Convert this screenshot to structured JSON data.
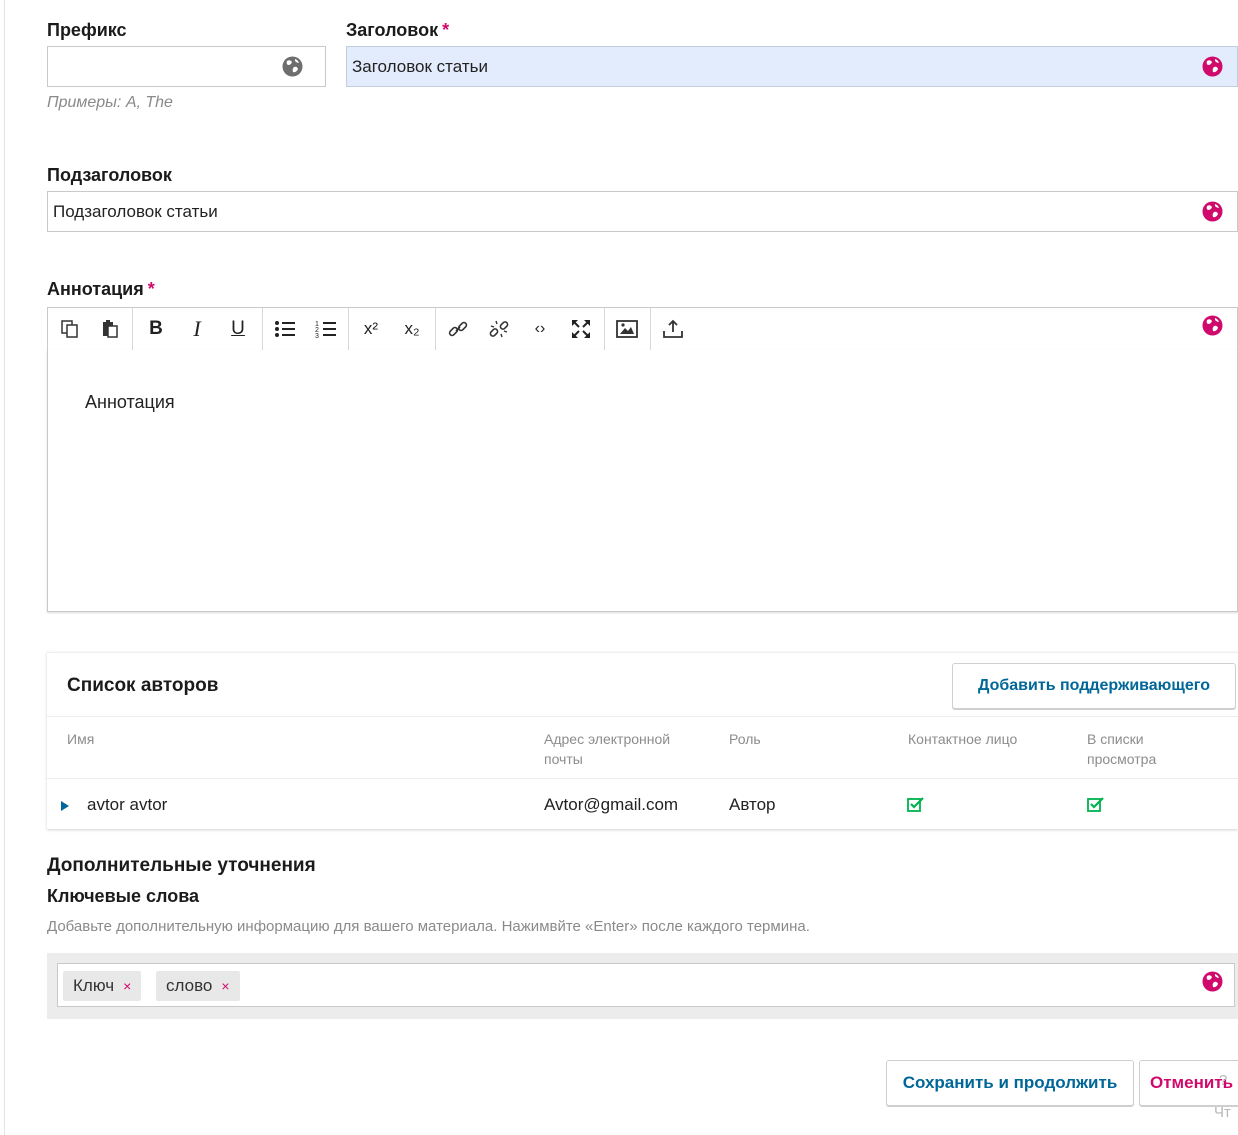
{
  "fields": {
    "prefix": {
      "label": "Префикс",
      "value": "",
      "hint": "Примеры: A, The"
    },
    "title": {
      "label": "Заголовок",
      "required_mark": "*",
      "value": "Заголовок статьи"
    },
    "subtitle": {
      "label": "Подзаголовок",
      "value": "Подзаголовок статьи"
    },
    "abstract": {
      "label": "Аннотация",
      "required_mark": "*",
      "value": "Аннотация"
    }
  },
  "toolbar": {
    "tools": [
      "copy-icon",
      "paste-icon",
      "bold-icon",
      "italic-icon",
      "underline-icon",
      "bullet-list-icon",
      "numbered-list-icon",
      "superscript-icon",
      "subscript-icon",
      "link-icon",
      "unlink-icon",
      "code-icon",
      "fullscreen-icon",
      "image-icon",
      "upload-icon"
    ],
    "bold": "B",
    "italic": "I",
    "underline": "U",
    "superscript": "x²",
    "subscript": "x₂",
    "code": "‹›"
  },
  "authors": {
    "title": "Список авторов",
    "add_button": "Добавить поддерживающего",
    "columns": [
      "Имя",
      "Адрес электронной почты",
      "Роль",
      "Контактное лицо",
      "В списки просмотра"
    ],
    "rows": [
      {
        "name": "avtor avtor",
        "email": "Avtor@gmail.com",
        "role": "Автор",
        "primary_contact": true,
        "in_browse_lists": true
      }
    ]
  },
  "additional": {
    "heading": "Дополнительные уточнения",
    "keywords_label": "Ключевые слова",
    "keywords_desc": "Добавьте дополнительную информацию для вашего материала. Нажимвйте «Enter» после каждого термина.",
    "keywords": [
      "Ключ",
      "слово"
    ],
    "remove_glyph": "×"
  },
  "actions": {
    "save": "Сохранить и продолжить",
    "cancel": "Отменить",
    "ghost_text_1": "?",
    "ghost_text_2": "Чт"
  },
  "colors": {
    "accent": "#d00a6c",
    "link": "#006798",
    "highlight": "#e3ecfc",
    "check": "#00b24e"
  }
}
